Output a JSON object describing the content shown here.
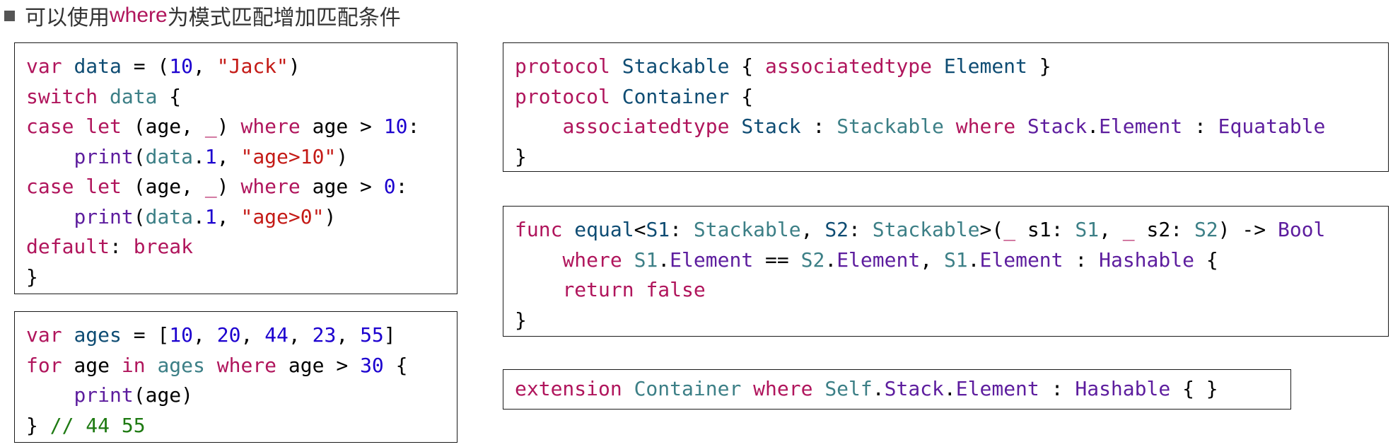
{
  "heading": {
    "prefix": "可以使用",
    "keyword": "where",
    "suffix": "为模式匹配增加匹配条件"
  },
  "code_blocks": [
    {
      "id": "switch-block",
      "lines": [
        [
          [
            "var",
            "kw"
          ],
          [
            " ",
            ""
          ],
          [
            "data",
            "tyd"
          ],
          [
            " = (",
            ""
          ],
          [
            "10",
            "num"
          ],
          [
            ", ",
            ""
          ],
          [
            "\"Jack\"",
            "str"
          ],
          [
            ")",
            ""
          ]
        ],
        [
          [
            "switch",
            "kw"
          ],
          [
            " ",
            ""
          ],
          [
            "data",
            "ty"
          ],
          [
            " {",
            ""
          ]
        ],
        [
          [
            "case",
            "kw"
          ],
          [
            " ",
            ""
          ],
          [
            "let",
            "kw"
          ],
          [
            " (age, ",
            ""
          ],
          [
            "_",
            "kw"
          ],
          [
            ") ",
            ""
          ],
          [
            "where",
            "kw"
          ],
          [
            " age > ",
            ""
          ],
          [
            "10",
            "num"
          ],
          [
            ":",
            ""
          ]
        ],
        [
          [
            "    ",
            ""
          ],
          [
            "print",
            "mem"
          ],
          [
            "(",
            ""
          ],
          [
            "data",
            "ty"
          ],
          [
            ".",
            ""
          ],
          [
            "1",
            "num"
          ],
          [
            ", ",
            ""
          ],
          [
            "\"age>10\"",
            "str"
          ],
          [
            ")",
            ""
          ]
        ],
        [
          [
            "case",
            "kw"
          ],
          [
            " ",
            ""
          ],
          [
            "let",
            "kw"
          ],
          [
            " (age, ",
            ""
          ],
          [
            "_",
            "kw"
          ],
          [
            ") ",
            ""
          ],
          [
            "where",
            "kw"
          ],
          [
            " age > ",
            ""
          ],
          [
            "0",
            "num"
          ],
          [
            ":",
            ""
          ]
        ],
        [
          [
            "    ",
            ""
          ],
          [
            "print",
            "mem"
          ],
          [
            "(",
            ""
          ],
          [
            "data",
            "ty"
          ],
          [
            ".",
            ""
          ],
          [
            "1",
            "num"
          ],
          [
            ", ",
            ""
          ],
          [
            "\"age>0\"",
            "str"
          ],
          [
            ")",
            ""
          ]
        ],
        [
          [
            "default",
            "kw"
          ],
          [
            ": ",
            ""
          ],
          [
            "break",
            "kw"
          ]
        ],
        [
          [
            "}",
            ""
          ]
        ]
      ]
    },
    {
      "id": "for-block",
      "lines": [
        [
          [
            "var",
            "kw"
          ],
          [
            " ",
            ""
          ],
          [
            "ages",
            "tyd"
          ],
          [
            " = [",
            ""
          ],
          [
            "10",
            "num"
          ],
          [
            ", ",
            ""
          ],
          [
            "20",
            "num"
          ],
          [
            ", ",
            ""
          ],
          [
            "44",
            "num"
          ],
          [
            ", ",
            ""
          ],
          [
            "23",
            "num"
          ],
          [
            ", ",
            ""
          ],
          [
            "55",
            "num"
          ],
          [
            "]",
            ""
          ]
        ],
        [
          [
            "for",
            "kw"
          ],
          [
            " age ",
            ""
          ],
          [
            "in",
            "kw"
          ],
          [
            " ",
            ""
          ],
          [
            "ages",
            "ty"
          ],
          [
            " ",
            ""
          ],
          [
            "where",
            "kw"
          ],
          [
            " age > ",
            ""
          ],
          [
            "30",
            "num"
          ],
          [
            " {",
            ""
          ]
        ],
        [
          [
            "    ",
            ""
          ],
          [
            "print",
            "mem"
          ],
          [
            "(age)",
            ""
          ]
        ],
        [
          [
            "} ",
            ""
          ],
          [
            "// 44 55",
            "cmt"
          ]
        ]
      ]
    },
    {
      "id": "protocol-block",
      "lines": [
        [
          [
            "protocol",
            "kw"
          ],
          [
            " ",
            ""
          ],
          [
            "Stackable",
            "tyd"
          ],
          [
            " { ",
            ""
          ],
          [
            "associatedtype",
            "kw"
          ],
          [
            " ",
            ""
          ],
          [
            "Element",
            "tyd"
          ],
          [
            " }",
            ""
          ]
        ],
        [
          [
            "protocol",
            "kw"
          ],
          [
            " ",
            ""
          ],
          [
            "Container",
            "tyd"
          ],
          [
            " {",
            ""
          ]
        ],
        [
          [
            "    ",
            ""
          ],
          [
            "associatedtype",
            "kw"
          ],
          [
            " ",
            ""
          ],
          [
            "Stack",
            "tyd"
          ],
          [
            " : ",
            ""
          ],
          [
            "Stackable",
            "ty"
          ],
          [
            " ",
            ""
          ],
          [
            "where",
            "kw"
          ],
          [
            " ",
            ""
          ],
          [
            "Stack",
            "mem"
          ],
          [
            ".",
            ""
          ],
          [
            "Element",
            "mem"
          ],
          [
            " : ",
            ""
          ],
          [
            "Equatable",
            "mem"
          ]
        ],
        [
          [
            "}",
            ""
          ]
        ]
      ]
    },
    {
      "id": "func-block",
      "lines": [
        [
          [
            "func",
            "kw"
          ],
          [
            " ",
            ""
          ],
          [
            "equal",
            "tyd"
          ],
          [
            "<",
            ""
          ],
          [
            "S1",
            "tyd"
          ],
          [
            ": ",
            ""
          ],
          [
            "Stackable",
            "ty"
          ],
          [
            ", ",
            ""
          ],
          [
            "S2",
            "tyd"
          ],
          [
            ": ",
            ""
          ],
          [
            "Stackable",
            "ty"
          ],
          [
            ">(",
            ""
          ],
          [
            "_",
            "kw"
          ],
          [
            " s1: ",
            ""
          ],
          [
            "S1",
            "ty"
          ],
          [
            ", ",
            ""
          ],
          [
            "_",
            "kw"
          ],
          [
            " s2: ",
            ""
          ],
          [
            "S2",
            "ty"
          ],
          [
            ") -> ",
            ""
          ],
          [
            "Bool",
            "mem"
          ]
        ],
        [
          [
            "    ",
            ""
          ],
          [
            "where",
            "kw"
          ],
          [
            " ",
            ""
          ],
          [
            "S1",
            "ty"
          ],
          [
            ".",
            ""
          ],
          [
            "Element",
            "mem"
          ],
          [
            " == ",
            ""
          ],
          [
            "S2",
            "ty"
          ],
          [
            ".",
            ""
          ],
          [
            "Element",
            "mem"
          ],
          [
            ", ",
            ""
          ],
          [
            "S1",
            "ty"
          ],
          [
            ".",
            ""
          ],
          [
            "Element",
            "mem"
          ],
          [
            " : ",
            ""
          ],
          [
            "Hashable",
            "mem"
          ],
          [
            " {",
            ""
          ]
        ],
        [
          [
            "    ",
            ""
          ],
          [
            "return",
            "kw"
          ],
          [
            " ",
            ""
          ],
          [
            "false",
            "kw"
          ]
        ],
        [
          [
            "}",
            ""
          ]
        ]
      ]
    },
    {
      "id": "extension-block",
      "lines": [
        [
          [
            "extension",
            "kw"
          ],
          [
            " ",
            ""
          ],
          [
            "Container",
            "ty"
          ],
          [
            " ",
            ""
          ],
          [
            "where",
            "kw"
          ],
          [
            " ",
            ""
          ],
          [
            "Self",
            "ty"
          ],
          [
            ".",
            ""
          ],
          [
            "Stack",
            "mem"
          ],
          [
            ".",
            ""
          ],
          [
            "Element",
            "mem"
          ],
          [
            " : ",
            ""
          ],
          [
            "Hashable",
            "mem"
          ],
          [
            " { }",
            ""
          ]
        ]
      ]
    }
  ]
}
